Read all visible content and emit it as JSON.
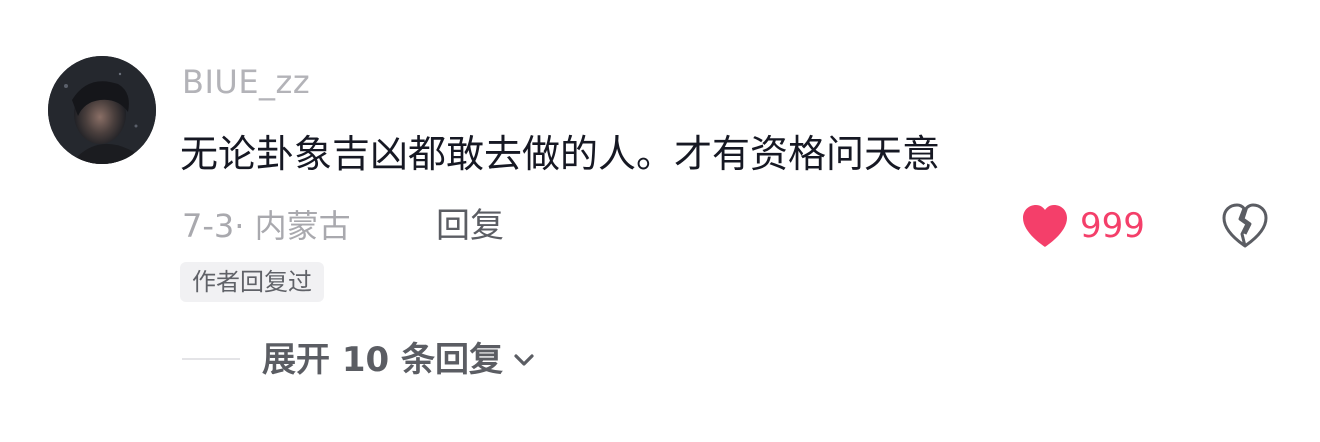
{
  "comment": {
    "username": "BIUE_zz",
    "text": "无论卦象吉凶都敢去做的人。才有资格问天意",
    "meta": "7-3· 内蒙古",
    "reply_label": "回复",
    "like_count": "999",
    "author_badge": "作者回复过",
    "expand_label": "展开 10 条回复"
  },
  "icons": {
    "avatar": "profile-photo",
    "like": "heart-icon",
    "dislike": "broken-heart-icon",
    "expand": "chevron-down-icon"
  },
  "colors": {
    "like_active": "#f43f6a",
    "username": "#b3b3b8",
    "text": "#161823",
    "secondary": "#5b5d63",
    "badge_bg": "#f1f1f3"
  }
}
